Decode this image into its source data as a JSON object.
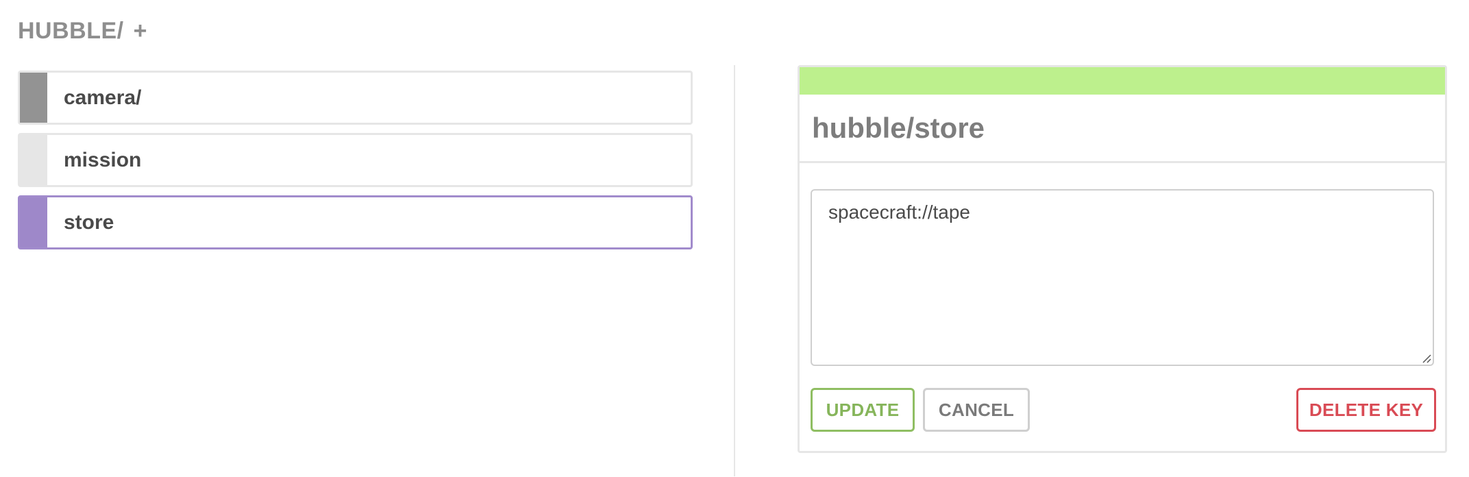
{
  "header": {
    "path": "HUBBLE/",
    "add_label": "+"
  },
  "keys": [
    {
      "label": "camera/",
      "kind": "directory"
    },
    {
      "label": "mission",
      "kind": "leaf"
    },
    {
      "label": "store",
      "kind": "leaf",
      "selected": true
    }
  ],
  "detail": {
    "title": "hubble/store",
    "value": "spacecraft://tape",
    "status_color": "#bdf08d",
    "buttons": {
      "update": "UPDATE",
      "cancel": "CANCEL",
      "delete": "DELETE KEY"
    }
  },
  "colors": {
    "accent_selected": "#9e88c9",
    "update": "#8fbe62",
    "delete": "#d94b55"
  }
}
